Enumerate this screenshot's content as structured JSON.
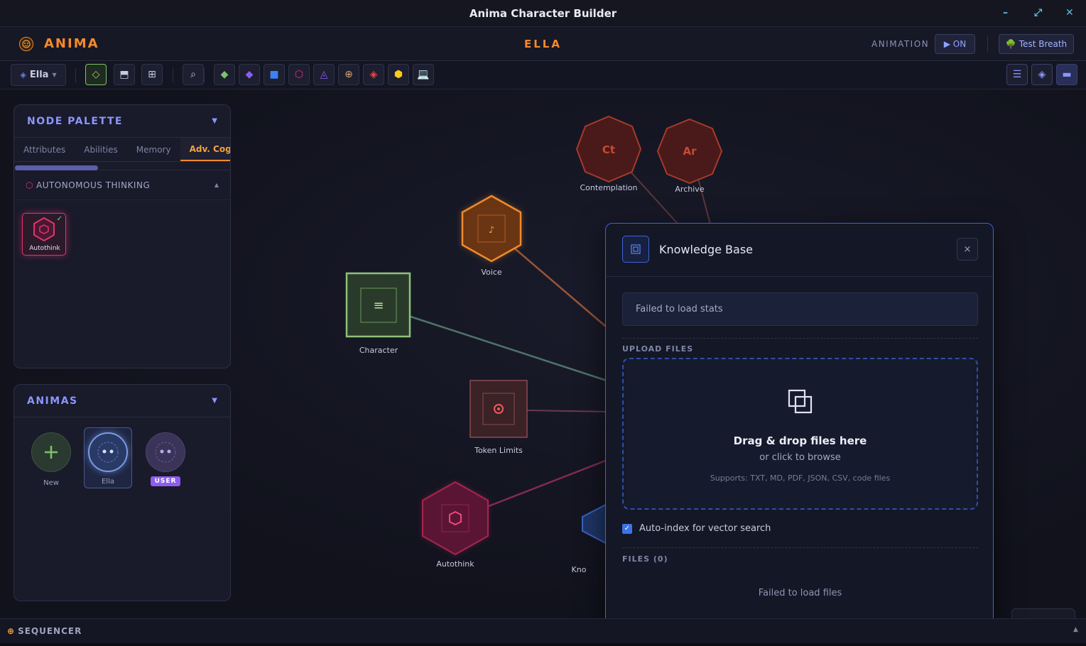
{
  "window": {
    "title": "Anima Character Builder",
    "minimize": "–",
    "maximize": "⤢",
    "close": "✕"
  },
  "header": {
    "brand": "ANIMA",
    "brand_icon": "face-icon",
    "current_anima": "ELLA",
    "animation_label": "ANIMATION",
    "animation_toggle": "▶ ON",
    "test_breath_icon": "🌳",
    "test_breath": "Test Breath"
  },
  "toolbar": {
    "anima_selector": "Ella",
    "tools": [
      {
        "name": "select-tool",
        "glyph": "◇",
        "color": "#9bd17a"
      },
      {
        "name": "panel-tool",
        "glyph": "⬒",
        "color": "#c8cbe0"
      },
      {
        "name": "grid-tool",
        "glyph": "⊞",
        "color": "#c8cbe0"
      },
      {
        "name": "search-tool",
        "glyph": "⌕",
        "color": "#c8cbe0"
      },
      {
        "name": "attribute-node",
        "glyph": "◆",
        "color": "#7fc26a"
      },
      {
        "name": "ability-node",
        "glyph": "◆",
        "color": "#8b5cf6"
      },
      {
        "name": "knowledge-node",
        "glyph": "■",
        "color": "#3b82f6"
      },
      {
        "name": "autothink-node",
        "glyph": "⬡",
        "color": "#e2336e"
      },
      {
        "name": "triangle-node",
        "glyph": "◬",
        "color": "#8b5cf6"
      },
      {
        "name": "globe-node",
        "glyph": "⊕",
        "color": "#d4a373"
      },
      {
        "name": "token-node",
        "glyph": "◈",
        "color": "#ef4444"
      },
      {
        "name": "hex-node",
        "glyph": "⬢",
        "color": "#facc15"
      },
      {
        "name": "computer-node",
        "glyph": "💻",
        "color": "#60a5fa"
      }
    ],
    "right_tools": [
      {
        "name": "list-view",
        "glyph": "☰",
        "color": "#8b95ff"
      },
      {
        "name": "node-view",
        "glyph": "◈",
        "color": "#8b95ff"
      },
      {
        "name": "collapse-view",
        "glyph": "▬",
        "color": "#8b95ff"
      }
    ]
  },
  "node_palette": {
    "title": "NODE PALETTE",
    "collapse_glyph": "▼",
    "tabs": [
      "Attributes",
      "Abilities",
      "Memory",
      "Adv. Cog"
    ],
    "active_tab": "Adv. Cog",
    "section": "AUTONOMOUS THINKING",
    "items": [
      {
        "label": "Autothink",
        "checked": true
      }
    ]
  },
  "animas_panel": {
    "title": "ANIMAS",
    "collapse_glyph": "▼",
    "items": [
      {
        "label": "New"
      },
      {
        "label": "Ella"
      },
      {
        "label": "",
        "badge": "USER"
      }
    ]
  },
  "graph": {
    "nodes": [
      {
        "label": "Contemplation",
        "abbr": "Ct"
      },
      {
        "label": "Archive",
        "abbr": "Ar"
      },
      {
        "label": "Voice"
      },
      {
        "label": "Character"
      },
      {
        "label": "Token Limits"
      },
      {
        "label": "Autothink"
      },
      {
        "label": "Kno"
      }
    ]
  },
  "knowledge_modal": {
    "title": "Knowledge Base",
    "close": "×",
    "stats_error": "Failed to load stats",
    "upload_label": "UPLOAD FILES",
    "drop_title": "Drag & drop files here",
    "drop_sub": "or click to browse",
    "drop_supports": "Supports: TXT, MD, PDF, JSON, CSV, code files",
    "auto_index_label": "Auto-index for vector search",
    "auto_index_checked": true,
    "files_label": "FILES (0)",
    "files_error": "Failed to load files"
  },
  "sequencer": {
    "icon": "⊕",
    "label": "SEQUENCER",
    "expand": "▲"
  }
}
